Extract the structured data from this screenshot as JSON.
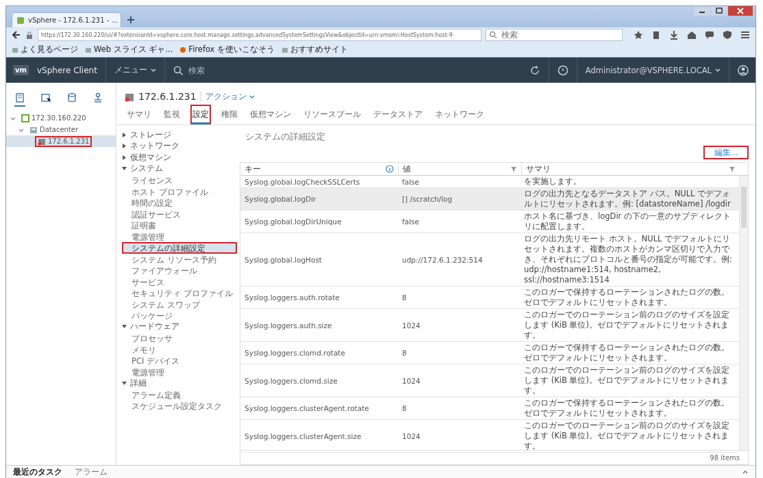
{
  "browser": {
    "tab_title": "vSphere - 172.6.1.231 - ...",
    "url": "https://172.30.160.220/ui/#?extensionId=vsphere.core.host.manage.settings.advancedSystemSettingsView&objectId=urn:vmomi:HostSystem:host-9",
    "search_placeholder": "検索",
    "bookmarks": [
      "よく見るページ",
      "Web スライス ギャ...",
      "Firefox を使いこなそう",
      "おすすめサイト"
    ]
  },
  "app_header": {
    "logo": "vm",
    "product": "vSphere Client",
    "menu": "メニュー",
    "search_placeholder": "検索",
    "user": "Administrator@VSPHERE.LOCAL"
  },
  "view_tabs": [
    {
      "selected": true
    },
    {
      "selected": false
    },
    {
      "selected": false
    },
    {
      "selected": false
    }
  ],
  "tree": [
    {
      "label": "172.30.160.220",
      "expanded": true,
      "selected": false,
      "highlighted": false,
      "children": [
        {
          "label": "Datacenter",
          "expanded": true,
          "selected": false,
          "highlighted": false,
          "children": [
            {
              "label": "172.6.1.231",
              "selected": true,
              "highlighted": true
            }
          ]
        }
      ]
    }
  ],
  "object": {
    "name": "172.6.1.231",
    "actions": "アクション"
  },
  "tabs": [
    {
      "label": "サマリ",
      "selected": false,
      "highlighted": false
    },
    {
      "label": "監視",
      "selected": false,
      "highlighted": false
    },
    {
      "label": "設定",
      "selected": true,
      "highlighted": true
    },
    {
      "label": "権限",
      "selected": false,
      "highlighted": false
    },
    {
      "label": "仮想マシン",
      "selected": false,
      "highlighted": false
    },
    {
      "label": "リソースプール",
      "selected": false,
      "highlighted": false
    },
    {
      "label": "データストア",
      "selected": false,
      "highlighted": false
    },
    {
      "label": "ネットワーク",
      "selected": false,
      "highlighted": false
    }
  ],
  "settings_nav": [
    {
      "label": "ストレージ",
      "expanded": false
    },
    {
      "label": "ネットワーク",
      "expanded": false
    },
    {
      "label": "仮想マシン",
      "expanded": false
    },
    {
      "label": "システム",
      "expanded": true,
      "children": [
        {
          "label": "ライセンス",
          "selected": false,
          "highlighted": false
        },
        {
          "label": "ホスト プロファイル",
          "selected": false,
          "highlighted": false
        },
        {
          "label": "時間の設定",
          "selected": false,
          "highlighted": false
        },
        {
          "label": "認証サービス",
          "selected": false,
          "highlighted": false
        },
        {
          "label": "証明書",
          "selected": false,
          "highlighted": false
        },
        {
          "label": "電源管理",
          "selected": false,
          "highlighted": false
        },
        {
          "label": "システムの詳細設定",
          "selected": true,
          "highlighted": true
        },
        {
          "label": "システム リソース予約",
          "selected": false,
          "highlighted": false
        },
        {
          "label": "ファイアウォール",
          "selected": false,
          "highlighted": false
        },
        {
          "label": "サービス",
          "selected": false,
          "highlighted": false
        },
        {
          "label": "セキュリティ プロファイル",
          "selected": false,
          "highlighted": false
        },
        {
          "label": "システム スワップ",
          "selected": false,
          "highlighted": false
        },
        {
          "label": "パッケージ",
          "selected": false,
          "highlighted": false
        }
      ]
    },
    {
      "label": "ハードウェア",
      "expanded": true,
      "children": [
        {
          "label": "プロセッサ",
          "selected": false,
          "highlighted": false
        },
        {
          "label": "メモリ",
          "selected": false,
          "highlighted": false
        },
        {
          "label": "PCI デバイス",
          "selected": false,
          "highlighted": false
        },
        {
          "label": "電源管理",
          "selected": false,
          "highlighted": false
        }
      ]
    },
    {
      "label": "詳細",
      "expanded": true,
      "children": [
        {
          "label": "アラーム定義",
          "selected": false,
          "highlighted": false
        },
        {
          "label": "スケジュール設定タスク",
          "selected": false,
          "highlighted": false
        }
      ]
    }
  ],
  "panel": {
    "title": "システムの詳細設定",
    "edit_button": {
      "label": "編集...",
      "highlighted": true
    },
    "columns": [
      "キー",
      "値",
      "サマリ"
    ],
    "rows": [
      {
        "key": "Syslog.global.logCheckSSLCerts",
        "value": "false",
        "summary": "を実施します。",
        "selected": false
      },
      {
        "key": "Syslog.global.logDir",
        "value": "[] /scratch/log",
        "summary": "ログの出力先となるデータストア パス。NULL でデフォルトにリセットされます。例: [datastoreName] /logdir",
        "selected": true
      },
      {
        "key": "Syslog.global.logDirUnique",
        "value": "false",
        "summary": "ホスト名に基づき、logDir の下の一意のサブディレクトリに配置します。",
        "selected": false
      },
      {
        "key": "Syslog.global.logHost",
        "value": "udp://172.6.1.232:514",
        "summary": "ログの出力先リモート ホスト。NULL でデフォルトにリセットされます。複数のホストがカンマ区切りで入力でき、それぞれにプロトコルと番号の指定が可能です。例: udp://hostname1:514, hostname2, ssl://hostname3:1514",
        "selected": false
      },
      {
        "key": "Syslog.loggers.auth.rotate",
        "value": "8",
        "summary": "このロガーで保持するローテーションされたログの数。ゼロでデフォルトにリセットされます。",
        "selected": false
      },
      {
        "key": "Syslog.loggers.auth.size",
        "value": "1024",
        "summary": "このロガーでのローテーション前のログのサイズを設定します (KiB 単位)。ゼロでデフォルトにリセットされます。",
        "selected": false
      },
      {
        "key": "Syslog.loggers.clomd.rotate",
        "value": "8",
        "summary": "このロガーで保持するローテーションされたログの数。ゼロでデフォルトにリセットされます。",
        "selected": false
      },
      {
        "key": "Syslog.loggers.clomd.size",
        "value": "1024",
        "summary": "このロガーでのローテーション前のログのサイズを設定します (KiB 単位)。ゼロでデフォルトにリセットされます。",
        "selected": false
      },
      {
        "key": "Syslog.loggers.clusterAgent.rotate",
        "value": "8",
        "summary": "このロガーで保持するローテーションされたログの数。ゼロでデフォルトにリセットされます。",
        "selected": false
      },
      {
        "key": "Syslog.loggers.clusterAgent.size",
        "value": "1024",
        "summary": "このロガーでのローテーション前のログのサイズを設定します (KiB 単位)。ゼロでデフォルトにリセットされます。",
        "selected": false
      }
    ],
    "footer": "98 items"
  },
  "bottom_bar": [
    {
      "label": "最近のタスク",
      "selected": true
    },
    {
      "label": "アラーム",
      "selected": false
    }
  ]
}
